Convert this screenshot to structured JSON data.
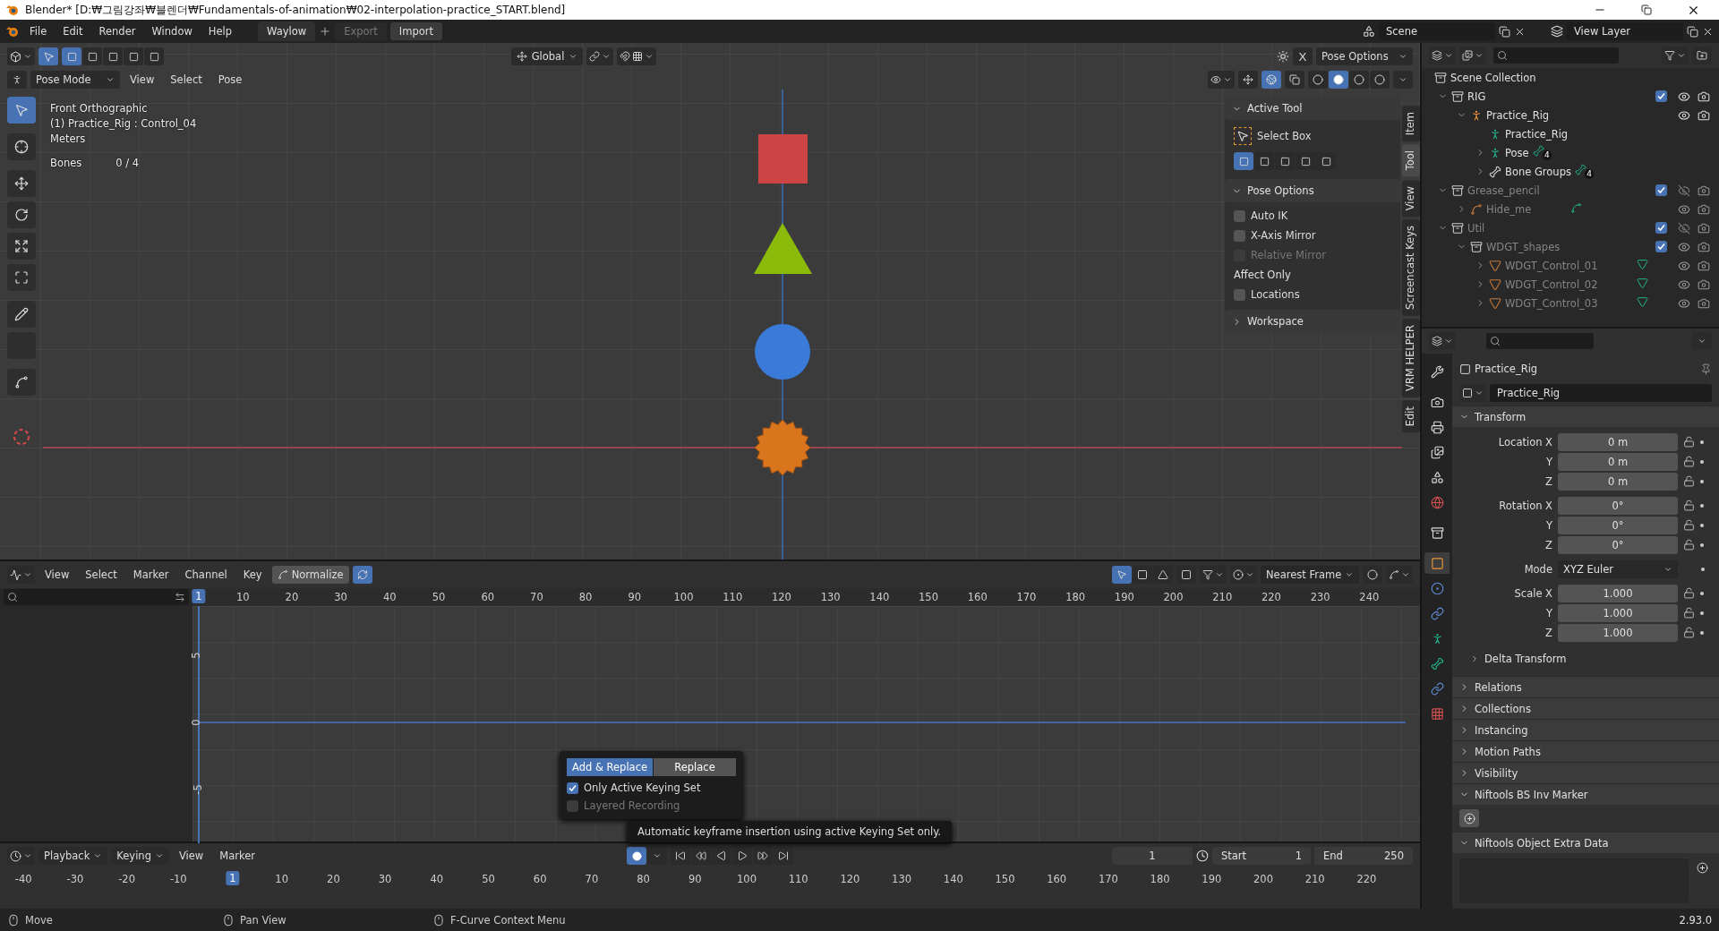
{
  "title_bar": {
    "title": "Blender* [D:₩그림강좌₩블렌더₩Fundamentals-of-animation₩02-interpolation-practice_START.blend]"
  },
  "top_bar": {
    "menus": [
      "File",
      "Edit",
      "Render",
      "Window",
      "Help"
    ],
    "workspaces": [
      {
        "label": "Waylow",
        "selected": true
      }
    ],
    "actions": [
      {
        "label": "Export",
        "disabled": true
      },
      {
        "label": "Import",
        "disabled": false
      }
    ],
    "scene": "Scene",
    "view_layer": "View Layer"
  },
  "viewport": {
    "select_modes": [
      {
        "selected": true
      },
      {
        "selected": false
      },
      {
        "selected": false
      },
      {
        "selected": false
      },
      {
        "selected": false
      }
    ],
    "orientation": "Global",
    "mirror_x": "X",
    "pose_options": "Pose Options",
    "mode": "Pose Mode",
    "menus": [
      "View",
      "Select",
      "Pose"
    ],
    "overlays_on": true,
    "shading": [
      {
        "selected": false
      },
      {
        "selected": true
      },
      {
        "selected": false
      },
      {
        "selected": false
      }
    ],
    "tools": [
      {
        "kind": "select",
        "selected": true
      },
      {
        "kind": "cursor",
        "selected": false
      },
      {
        "kind": "move",
        "selected": false
      },
      {
        "kind": "rotate",
        "selected": false
      },
      {
        "kind": "scale",
        "selected": false
      },
      {
        "kind": "transform",
        "selected": false
      },
      {
        "kind": "annotate",
        "selected": false
      },
      {
        "kind": "measure",
        "selected": false
      },
      {
        "kind": "relax",
        "selected": false
      }
    ],
    "info": [
      "Front Orthographic",
      "(1) Practice_Rig : Control_04",
      "Meters"
    ],
    "bones_label": "Bones",
    "bones_value": "0 / 4"
  },
  "n_panel": {
    "tabs": [
      {
        "label": "Item",
        "selected": false
      },
      {
        "label": "Tool",
        "selected": true
      },
      {
        "label": "View",
        "selected": false
      },
      {
        "label": "Screencast Keys",
        "selected": false
      },
      {
        "label": "VRM HELPER",
        "selected": false
      },
      {
        "label": "Edit",
        "selected": false
      }
    ],
    "active_tool_title": "Active Tool",
    "tool_name": "Select Box",
    "tool_modes": [
      {
        "selected": true
      },
      {
        "selected": false
      },
      {
        "selected": false
      },
      {
        "selected": false
      },
      {
        "selected": false
      }
    ],
    "pose_options_title": "Pose Options",
    "options": [
      {
        "kind": "checkbox",
        "label": "Auto IK",
        "checked": false,
        "disabled": false
      },
      {
        "kind": "checkbox",
        "label": "X-Axis Mirror",
        "checked": false,
        "disabled": false
      },
      {
        "kind": "checkbox",
        "label": "Relative Mirror",
        "checked": false,
        "disabled": true
      },
      {
        "kind": "label",
        "label": "Affect Only"
      },
      {
        "kind": "checkbox",
        "label": "Locations",
        "checked": false,
        "disabled": false
      }
    ],
    "workspace_title": "Workspace"
  },
  "graph_editor": {
    "menus": [
      "View",
      "Select",
      "Marker",
      "Channel",
      "Key"
    ],
    "normalize": {
      "label": "Normalize",
      "on": false
    },
    "snap": "Nearest Frame",
    "playhead": "1",
    "frame_ticks": [
      "10",
      "20",
      "30",
      "40",
      "50",
      "60",
      "70",
      "80",
      "90",
      "100",
      "110",
      "120",
      "130",
      "140",
      "150",
      "160",
      "170",
      "180",
      "190",
      "200",
      "210",
      "220",
      "230",
      "240"
    ],
    "value_ticks": [
      "5",
      "0",
      "-5"
    ],
    "popup": {
      "tabs": [
        {
          "label": "Add & Replace",
          "selected": true
        },
        {
          "label": "Replace",
          "selected": false
        }
      ],
      "options": [
        {
          "label": "Only Active Keying Set",
          "checked": true,
          "disabled": false
        },
        {
          "label": "Layered Recording",
          "checked": false,
          "disabled": true
        }
      ]
    },
    "tooltip": "Automatic keyframe insertion using active Keying Set only."
  },
  "timeline": {
    "dropdowns": [
      "Playback",
      "Keying"
    ],
    "menus": [
      "View",
      "Marker"
    ],
    "auto_keying": true,
    "current_frame": "1",
    "start_label": "Start",
    "start": "1",
    "end_label": "End",
    "end": "250",
    "playhead": "1",
    "ticks": [
      "-40",
      "-30",
      "-20",
      "-10",
      "10",
      "20",
      "30",
      "40",
      "50",
      "60",
      "70",
      "80",
      "90",
      "100",
      "110",
      "120",
      "130",
      "140",
      "150",
      "160",
      "170",
      "180",
      "190",
      "200",
      "210",
      "220"
    ]
  },
  "outliner": {
    "root": "Scene Collection",
    "tree": [
      {
        "kind": "collection",
        "name": "RIG",
        "expanded": true,
        "checked": true,
        "visible": true,
        "children": [
          {
            "kind": "armature",
            "name": "Practice_Rig",
            "expanded": true,
            "visible": true,
            "children": [
              {
                "kind": "armature_data",
                "name": "Practice_Rig"
              },
              {
                "kind": "pose",
                "name": "Pose",
                "expanded": false,
                "badge": "4"
              },
              {
                "kind": "bone_groups",
                "name": "Bone Groups",
                "expanded": false,
                "badge": "4"
              }
            ]
          }
        ]
      },
      {
        "kind": "collection",
        "name": "Grease_pencil",
        "expanded": true,
        "checked": true,
        "visible": false,
        "children": [
          {
            "kind": "gpencil",
            "name": "Hide_me",
            "expanded": false,
            "visible": true
          }
        ]
      },
      {
        "kind": "collection",
        "name": "Util",
        "expanded": true,
        "checked": true,
        "visible": false,
        "children": [
          {
            "kind": "collection",
            "name": "WDGT_shapes",
            "expanded": true,
            "checked": true,
            "visible": true,
            "children": [
              {
                "kind": "mesh",
                "name": "WDGT_Control_01",
                "expanded": false,
                "visible": true
              },
              {
                "kind": "mesh",
                "name": "WDGT_Control_02",
                "expanded": false,
                "visible": true
              },
              {
                "kind": "mesh",
                "name": "WDGT_Control_03",
                "expanded": false,
                "visible": true
              }
            ]
          }
        ]
      }
    ]
  },
  "properties": {
    "tabs": [
      {
        "kind": "tool",
        "selected": false
      },
      {
        "kind": "render",
        "selected": false
      },
      {
        "kind": "output",
        "selected": false
      },
      {
        "kind": "view_layer",
        "selected": false
      },
      {
        "kind": "scene",
        "selected": false
      },
      {
        "kind": "world",
        "selected": false
      },
      {
        "kind": "collection",
        "selected": false
      },
      {
        "kind": "object",
        "selected": true
      },
      {
        "kind": "physics",
        "selected": false
      },
      {
        "kind": "constraint",
        "selected": false
      },
      {
        "kind": "data",
        "selected": false
      },
      {
        "kind": "bone",
        "selected": false
      },
      {
        "kind": "bone_constraint",
        "selected": false
      },
      {
        "kind": "texture",
        "selected": false
      }
    ],
    "object": "Practice_Rig",
    "name_field": "Practice_Rig",
    "transform_title": "Transform",
    "groups": [
      [
        {
          "kind": "number",
          "label": "Location X",
          "value": "0 m"
        },
        {
          "kind": "number",
          "label": "Y",
          "value": "0 m"
        },
        {
          "kind": "number",
          "label": "Z",
          "value": "0 m"
        }
      ],
      [
        {
          "kind": "number",
          "label": "Rotation X",
          "value": "0°"
        },
        {
          "kind": "number",
          "label": "Y",
          "value": "0°"
        },
        {
          "kind": "number",
          "label": "Z",
          "value": "0°"
        }
      ],
      [
        {
          "kind": "dropdown",
          "label": "Mode",
          "value": "XYZ Euler"
        }
      ],
      [
        {
          "kind": "number",
          "label": "Scale X",
          "value": "1.000"
        },
        {
          "kind": "number",
          "label": "Y",
          "value": "1.000"
        },
        {
          "kind": "number",
          "label": "Z",
          "value": "1.000"
        }
      ]
    ],
    "delta": "Delta Transform",
    "panels": [
      {
        "title": "Relations",
        "expanded": false
      },
      {
        "title": "Collections",
        "expanded": false
      },
      {
        "title": "Instancing",
        "expanded": false
      },
      {
        "title": "Motion Paths",
        "expanded": false
      },
      {
        "title": "Visibility",
        "expanded": false
      },
      {
        "title": "Niftools BS Inv Marker",
        "expanded": true,
        "kind": "add_button"
      },
      {
        "title": "Niftools Object Extra Data",
        "expanded": true,
        "kind": "list"
      }
    ]
  },
  "status_bar": {
    "hints": [
      "Move",
      "Pan View",
      "F-Curve Context Menu"
    ],
    "version": "2.93.0"
  }
}
